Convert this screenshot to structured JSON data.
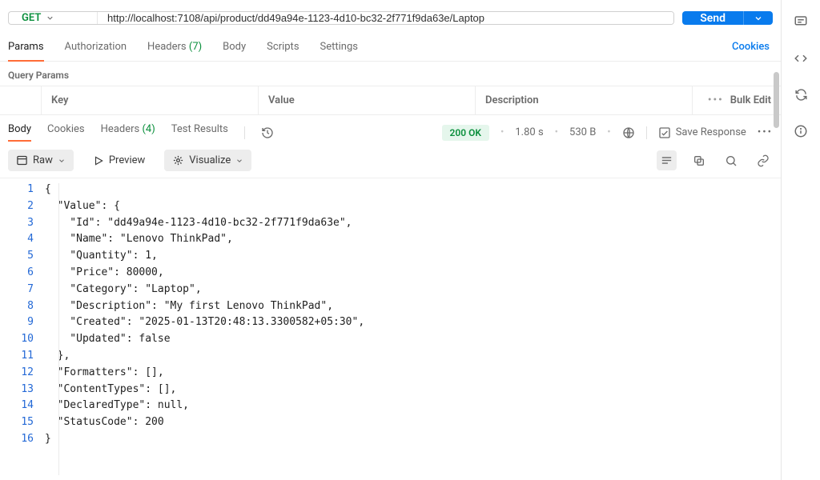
{
  "request": {
    "method": "GET",
    "url": "http://localhost:7108/api/product/dd49a94e-1123-4d10-bc32-2f771f9da63e/Laptop",
    "send_label": "Send"
  },
  "request_tabs": {
    "params": "Params",
    "authorization": "Authorization",
    "headers_label": "Headers",
    "headers_count": "(7)",
    "body": "Body",
    "scripts": "Scripts",
    "settings": "Settings",
    "cookies_link": "Cookies"
  },
  "query_params": {
    "title": "Query Params",
    "key": "Key",
    "value": "Value",
    "description": "Description",
    "bulk_edit": "Bulk Edit"
  },
  "response_tabs": {
    "body": "Body",
    "cookies": "Cookies",
    "headers_label": "Headers",
    "headers_count": "(4)",
    "test_results": "Test Results"
  },
  "response_status": {
    "status": "200 OK",
    "time": "1.80 s",
    "size": "530 B",
    "save_response": "Save Response"
  },
  "view_modes": {
    "raw": "Raw",
    "preview": "Preview",
    "visualize": "Visualize"
  },
  "code_lines": [
    "{",
    "  \"Value\": {",
    "    \"Id\": \"dd49a94e-1123-4d10-bc32-2f771f9da63e\",",
    "    \"Name\": \"Lenovo ThinkPad\",",
    "    \"Quantity\": 1,",
    "    \"Price\": 80000,",
    "    \"Category\": \"Laptop\",",
    "    \"Description\": \"My first Lenovo ThinkPad\",",
    "    \"Created\": \"2025-01-13T20:48:13.3300582+05:30\",",
    "    \"Updated\": false",
    "  },",
    "  \"Formatters\": [],",
    "  \"ContentTypes\": [],",
    "  \"DeclaredType\": null,",
    "  \"StatusCode\": 200",
    "}"
  ]
}
